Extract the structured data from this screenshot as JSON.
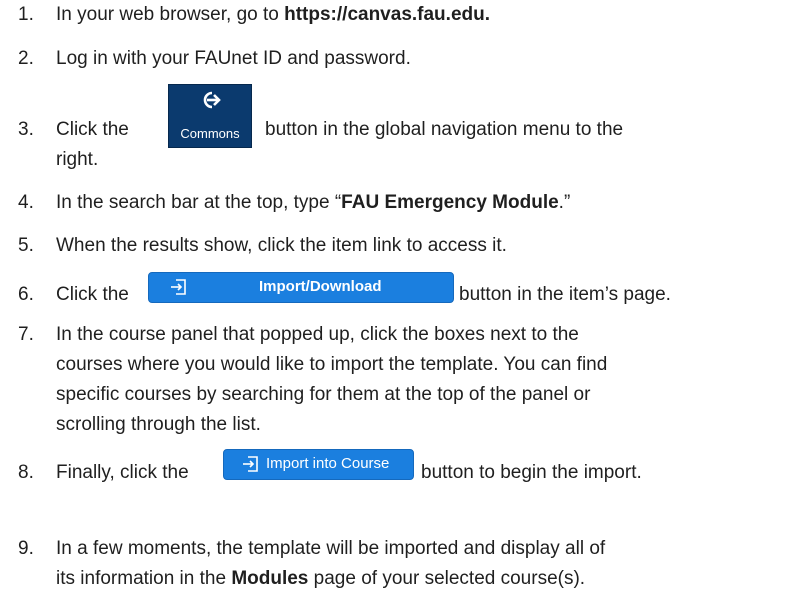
{
  "steps": [
    {
      "num": "1.",
      "pre": "In your web browser, go to ",
      "bold": "https://canvas.fau.edu.",
      "post": ""
    },
    {
      "num": "2.",
      "text": "Log in with your FAUnet ID and password."
    },
    {
      "num": "3.",
      "pre": "Click the",
      "post": "button in the global navigation menu to the",
      "cont": "right."
    },
    {
      "num": "4.",
      "pre": "In the search bar at the top, type “",
      "bold": "FAU Emergency Module",
      "post": ".”"
    },
    {
      "num": "5.",
      "text": "When the results show, click the item link to access it."
    },
    {
      "num": "6.",
      "pre": "Click the",
      "post": "button in the item’s page."
    },
    {
      "num": "7.",
      "lines": [
        "In the course panel that popped up, click the boxes next to the",
        "courses where you would like to import the template. You can find",
        "specific courses by searching for them at the top of the panel or",
        "scrolling through the list."
      ]
    },
    {
      "num": "8.",
      "pre": "Finally, click the",
      "post": "button to begin the import."
    },
    {
      "num": "9.",
      "line1": "In a few moments, the template will be imported and display all of",
      "pre2": "its information in the ",
      "bold2": "Modules",
      "post2": " page of your selected course(s)."
    }
  ],
  "buttons": {
    "commons": {
      "label": "Commons",
      "icon": "arrow-right-icon",
      "color": "#0b3a6e"
    },
    "import_download": {
      "label": "Import/Download",
      "icon": "import-icon",
      "color": "#1b7fdf"
    },
    "import_into_course": {
      "label": "Import into Course",
      "icon": "import-icon",
      "color": "#1b7fdf"
    }
  }
}
